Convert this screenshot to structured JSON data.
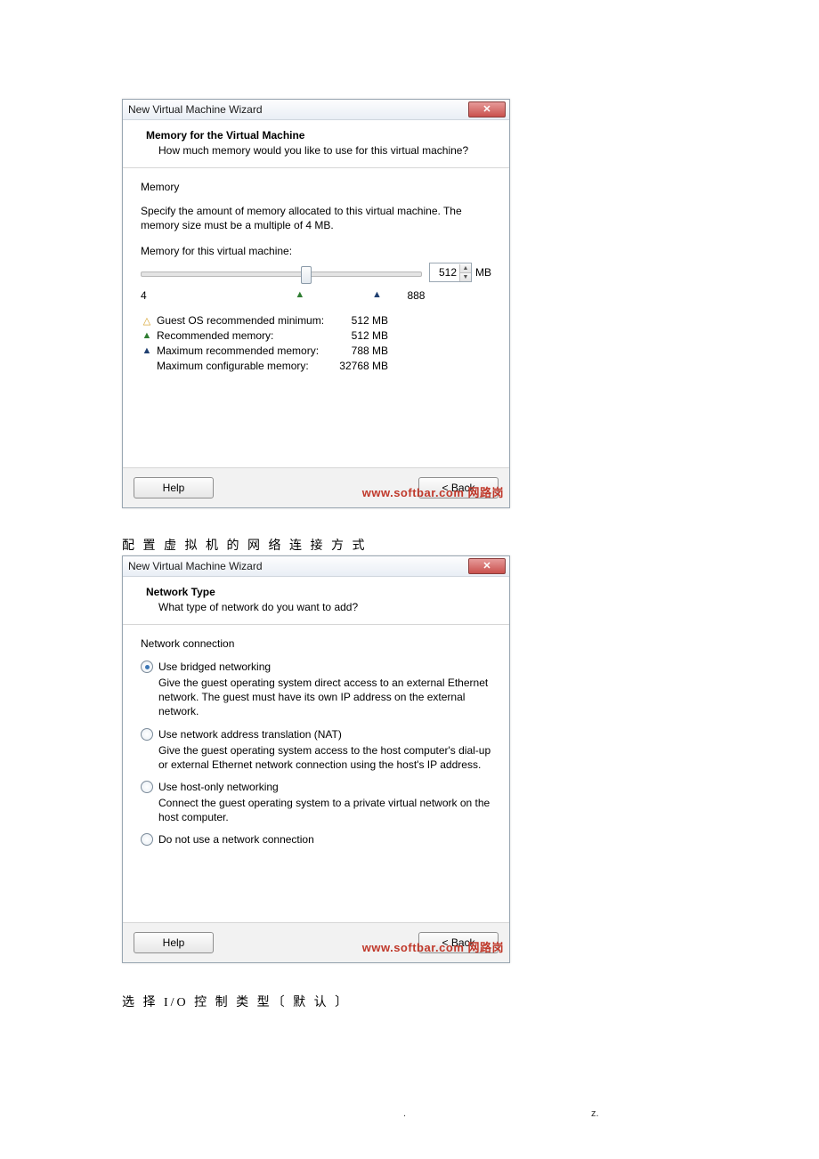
{
  "dialog1": {
    "title": "New Virtual Machine Wizard",
    "header_title": "Memory for the Virtual Machine",
    "header_sub": "How much memory would you like to use for this virtual machine?",
    "section": "Memory",
    "desc": "Specify the amount of memory allocated to this virtual machine. The memory size must be a multiple of 4 MB.",
    "mem_label": "Memory for this virtual machine:",
    "value": "512",
    "unit": "MB",
    "axis_min": "4",
    "axis_max": "888",
    "rec": [
      {
        "icon": "△",
        "color": "#d6a12a",
        "label": "Guest OS recommended minimum:",
        "value": "512 MB"
      },
      {
        "icon": "▲",
        "color": "#2f7d32",
        "label": "Recommended memory:",
        "value": "512 MB"
      },
      {
        "icon": "▲",
        "color": "#1f3f70",
        "label": "Maximum recommended memory:",
        "value": "788 MB"
      },
      {
        "icon": "",
        "color": "",
        "label": "Maximum configurable memory:",
        "value": "32768 MB"
      }
    ],
    "help": "Help",
    "back": "< Back",
    "watermark": "www.softbar.com 网路岗"
  },
  "caption1": "配 置 虚 拟 机 的 网 络 连 接 方 式",
  "dialog2": {
    "title": "New Virtual Machine Wizard",
    "header_title": "Network Type",
    "header_sub": "What type of network do you want to add?",
    "section": "Network connection",
    "options": [
      {
        "label": "Use bridged networking",
        "desc": "Give the guest operating system direct access to an external Ethernet network. The guest must have its own IP address on the external network.",
        "checked": true
      },
      {
        "label": "Use network address translation (NAT)",
        "desc": "Give the guest operating system access to the host computer's dial-up or external Ethernet network connection using the host's IP address.",
        "checked": false
      },
      {
        "label": "Use host-only networking",
        "desc": "Connect the guest operating system to a private virtual network on the host computer.",
        "checked": false
      },
      {
        "label": "Do not use a network connection",
        "desc": "",
        "checked": false
      }
    ],
    "help": "Help",
    "back": "< Back",
    "watermark": "www.softbar.com 网路岗"
  },
  "caption2": "选 择 I/O 控 制 类 型〔 默 认 〕",
  "footnote_dot": ".",
  "footnote_z": "z."
}
